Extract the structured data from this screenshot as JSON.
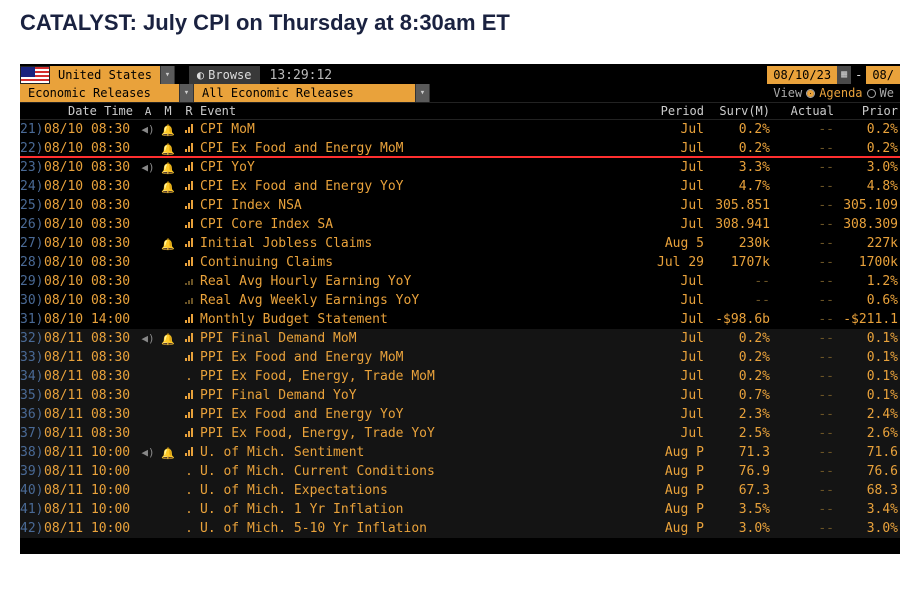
{
  "headline": "CATALYST: July CPI on Thursday at 8:30am ET",
  "toolbar": {
    "country": "United States",
    "browse": "Browse",
    "clock": "13:29:12",
    "date_from": "08/10/23",
    "date_to": "08/",
    "filter1": "Economic Releases",
    "filter2": "All Economic Releases",
    "view_label": "View",
    "agenda_label": "Agenda",
    "weekly_label": "We"
  },
  "columns": {
    "datetime": "Date Time",
    "a": "A",
    "m": "M",
    "r": "R",
    "event": "Event",
    "period": "Period",
    "surv": "Surv(M)",
    "actual": "Actual",
    "prior": "Prior",
    "revised": "R"
  },
  "rows": [
    {
      "n": "21)",
      "dt": "08/10 08:30",
      "spk": true,
      "bell": true,
      "bar": "high",
      "event": "CPI MoM",
      "period": "Jul",
      "surv": "0.2%",
      "actual": "--",
      "prior": "0.2%",
      "zebra": false,
      "hl": false
    },
    {
      "n": "22)",
      "dt": "08/10 08:30",
      "spk": false,
      "bell": true,
      "bar": "high",
      "event": "CPI Ex Food and Energy MoM",
      "period": "Jul",
      "surv": "0.2%",
      "actual": "--",
      "prior": "0.2%",
      "zebra": false,
      "hl": true
    },
    {
      "n": "23)",
      "dt": "08/10 08:30",
      "spk": true,
      "bell": true,
      "bar": "high",
      "event": "CPI YoY",
      "period": "Jul",
      "surv": "3.3%",
      "actual": "--",
      "prior": "3.0%",
      "zebra": false,
      "hl": false
    },
    {
      "n": "24)",
      "dt": "08/10 08:30",
      "spk": false,
      "bell": true,
      "bar": "high",
      "event": "CPI Ex Food and Energy YoY",
      "period": "Jul",
      "surv": "4.7%",
      "actual": "--",
      "prior": "4.8%",
      "zebra": false,
      "hl": false
    },
    {
      "n": "25)",
      "dt": "08/10 08:30",
      "spk": false,
      "bell": false,
      "bar": "high",
      "event": "CPI Index NSA",
      "period": "Jul",
      "surv": "305.851",
      "actual": "--",
      "prior": "305.109",
      "zebra": false,
      "hl": false
    },
    {
      "n": "26)",
      "dt": "08/10 08:30",
      "spk": false,
      "bell": false,
      "bar": "high",
      "event": "CPI Core Index SA",
      "period": "Jul",
      "surv": "308.941",
      "actual": "--",
      "prior": "308.309",
      "zebra": false,
      "hl": false
    },
    {
      "n": "27)",
      "dt": "08/10 08:30",
      "spk": false,
      "bell": true,
      "bar": "high",
      "event": "Initial Jobless Claims",
      "period": "Aug 5",
      "surv": "230k",
      "actual": "--",
      "prior": "227k",
      "zebra": false,
      "hl": false
    },
    {
      "n": "28)",
      "dt": "08/10 08:30",
      "spk": false,
      "bell": false,
      "bar": "high",
      "event": "Continuing Claims",
      "period": "Jul 29",
      "surv": "1707k",
      "actual": "--",
      "prior": "1700k",
      "zebra": false,
      "hl": false
    },
    {
      "n": "29)",
      "dt": "08/10 08:30",
      "spk": false,
      "bell": false,
      "bar": "low",
      "event": "Real Avg Hourly Earning YoY",
      "period": "Jul",
      "surv": "--",
      "actual": "--",
      "prior": "1.2%",
      "zebra": false,
      "hl": false
    },
    {
      "n": "30)",
      "dt": "08/10 08:30",
      "spk": false,
      "bell": false,
      "bar": "low",
      "event": "Real Avg Weekly Earnings YoY",
      "period": "Jul",
      "surv": "--",
      "actual": "--",
      "prior": "0.6%",
      "zebra": false,
      "hl": false
    },
    {
      "n": "31)",
      "dt": "08/10 14:00",
      "spk": false,
      "bell": false,
      "bar": "high",
      "event": "Monthly Budget Statement",
      "period": "Jul",
      "surv": "-$98.6b",
      "actual": "--",
      "prior": "-$211.1",
      "zebra": false,
      "hl": false
    },
    {
      "n": "32)",
      "dt": "08/11 08:30",
      "spk": true,
      "bell": true,
      "bar": "high",
      "event": "PPI Final Demand MoM",
      "period": "Jul",
      "surv": "0.2%",
      "actual": "--",
      "prior": "0.1%",
      "zebra": true,
      "hl": false
    },
    {
      "n": "33)",
      "dt": "08/11 08:30",
      "spk": false,
      "bell": false,
      "bar": "high",
      "event": "PPI Ex Food and Energy MoM",
      "period": "Jul",
      "surv": "0.2%",
      "actual": "--",
      "prior": "0.1%",
      "zebra": true,
      "hl": false
    },
    {
      "n": "34)",
      "dt": "08/11 08:30",
      "spk": false,
      "bell": false,
      "bar": "dot",
      "event": "PPI Ex Food, Energy, Trade MoM",
      "period": "Jul",
      "surv": "0.2%",
      "actual": "--",
      "prior": "0.1%",
      "zebra": true,
      "hl": false
    },
    {
      "n": "35)",
      "dt": "08/11 08:30",
      "spk": false,
      "bell": false,
      "bar": "high",
      "event": "PPI Final Demand YoY",
      "period": "Jul",
      "surv": "0.7%",
      "actual": "--",
      "prior": "0.1%",
      "zebra": true,
      "hl": false
    },
    {
      "n": "36)",
      "dt": "08/11 08:30",
      "spk": false,
      "bell": false,
      "bar": "high",
      "event": "PPI Ex Food and Energy YoY",
      "period": "Jul",
      "surv": "2.3%",
      "actual": "--",
      "prior": "2.4%",
      "zebra": true,
      "hl": false
    },
    {
      "n": "37)",
      "dt": "08/11 08:30",
      "spk": false,
      "bell": false,
      "bar": "high",
      "event": "PPI Ex Food, Energy, Trade YoY",
      "period": "Jul",
      "surv": "2.5%",
      "actual": "--",
      "prior": "2.6%",
      "zebra": true,
      "hl": false
    },
    {
      "n": "38)",
      "dt": "08/11 10:00",
      "spk": true,
      "bell": true,
      "bar": "high",
      "event": "U. of Mich. Sentiment",
      "period": "Aug P",
      "surv": "71.3",
      "actual": "--",
      "prior": "71.6",
      "zebra": true,
      "hl": false
    },
    {
      "n": "39)",
      "dt": "08/11 10:00",
      "spk": false,
      "bell": false,
      "bar": "dot",
      "event": "U. of Mich. Current Conditions",
      "period": "Aug P",
      "surv": "76.9",
      "actual": "--",
      "prior": "76.6",
      "zebra": true,
      "hl": false
    },
    {
      "n": "40)",
      "dt": "08/11 10:00",
      "spk": false,
      "bell": false,
      "bar": "dot",
      "event": "U. of Mich. Expectations",
      "period": "Aug P",
      "surv": "67.3",
      "actual": "--",
      "prior": "68.3",
      "zebra": true,
      "hl": false
    },
    {
      "n": "41)",
      "dt": "08/11 10:00",
      "spk": false,
      "bell": false,
      "bar": "dot",
      "event": "U. of Mich. 1 Yr Inflation",
      "period": "Aug P",
      "surv": "3.5%",
      "actual": "--",
      "prior": "3.4%",
      "zebra": true,
      "hl": false
    },
    {
      "n": "42)",
      "dt": "08/11 10:00",
      "spk": false,
      "bell": false,
      "bar": "dot",
      "event": "U. of Mich. 5-10 Yr Inflation",
      "period": "Aug P",
      "surv": "3.0%",
      "actual": "--",
      "prior": "3.0%",
      "zebra": true,
      "hl": false
    }
  ]
}
